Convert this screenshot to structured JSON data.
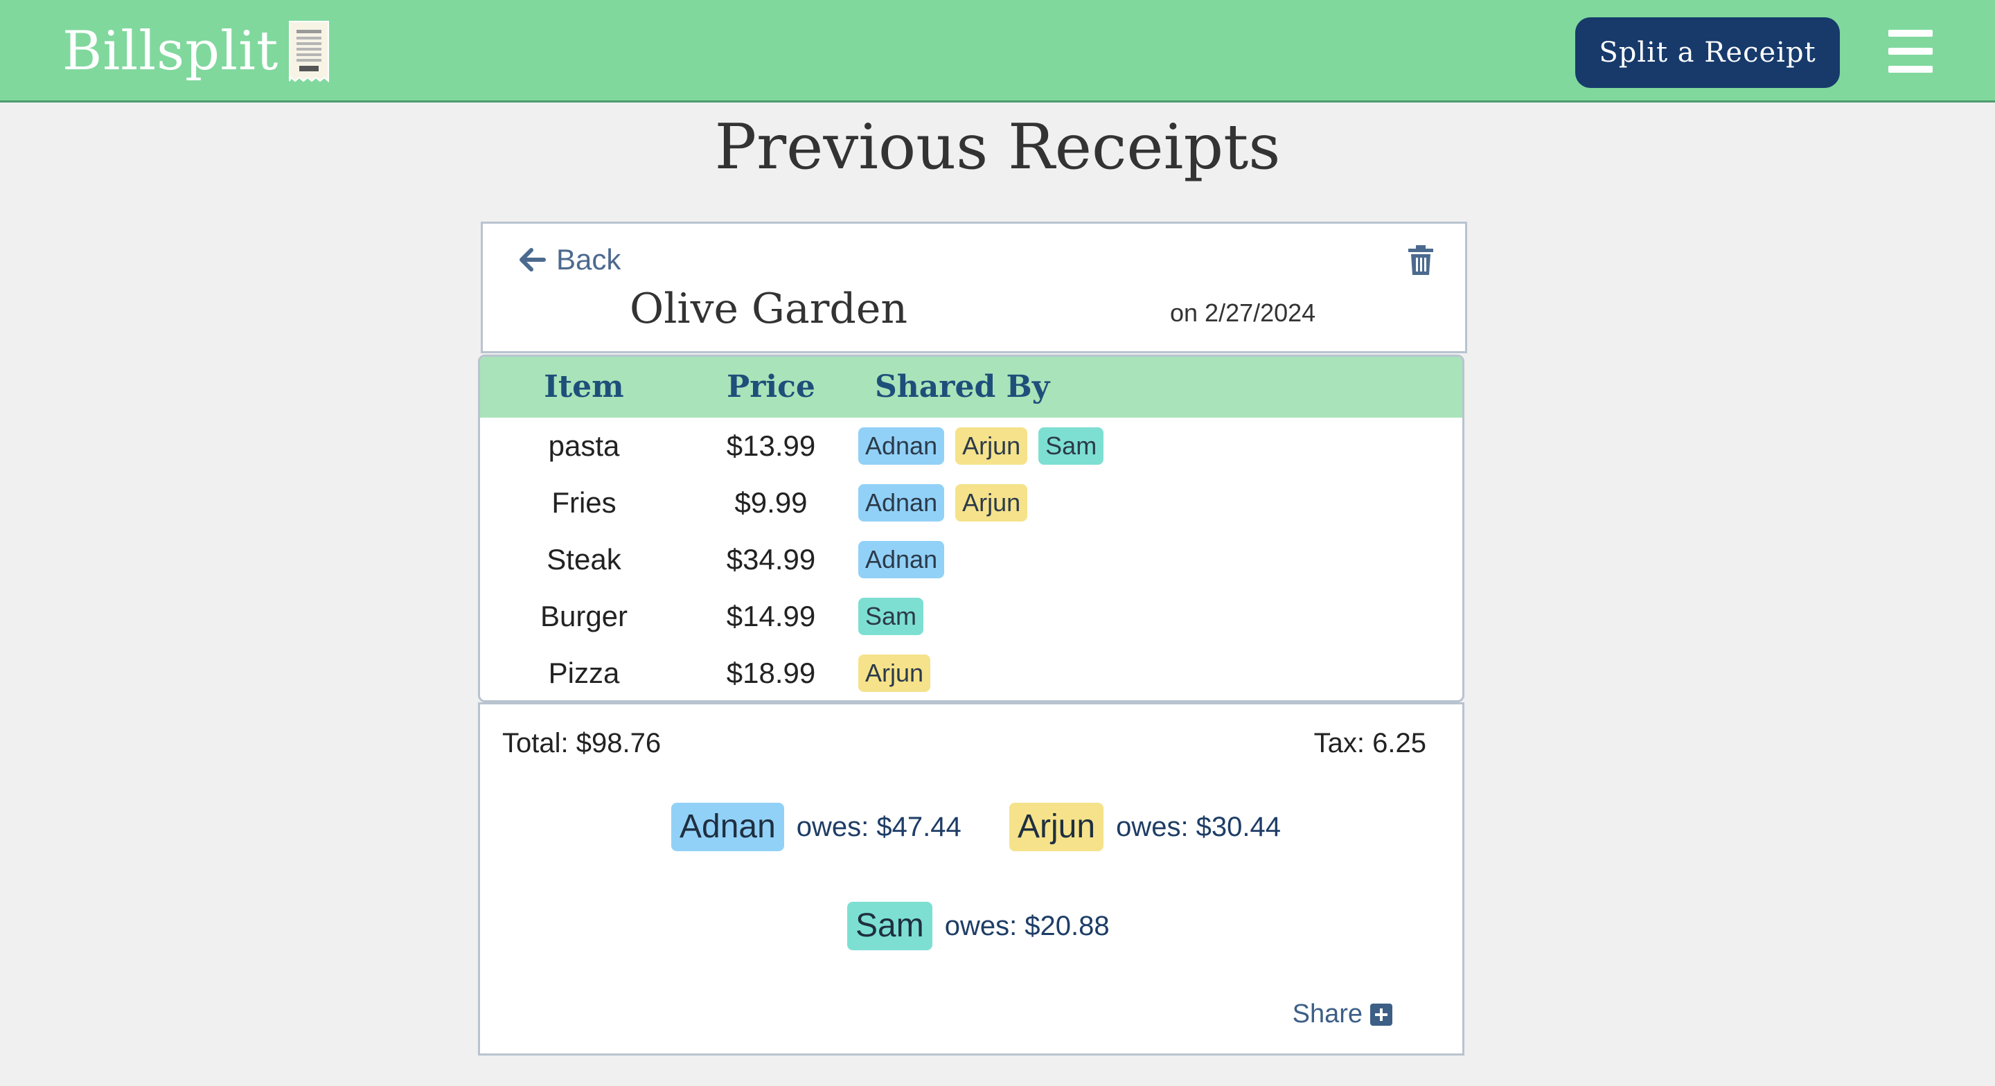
{
  "header": {
    "brand": "Billsplit",
    "split_button": "Split a Receipt"
  },
  "page_title": "Previous Receipts",
  "receipt": {
    "back_label": "Back",
    "restaurant": "Olive Garden",
    "date_text": "on 2/27/2024"
  },
  "table": {
    "columns": [
      "Item",
      "Price",
      "Shared By"
    ],
    "rows": [
      {
        "item": "pasta",
        "price": "$13.99",
        "shared_by": [
          "Adnan",
          "Arjun",
          "Sam"
        ]
      },
      {
        "item": "Fries",
        "price": "$9.99",
        "shared_by": [
          "Adnan",
          "Arjun"
        ]
      },
      {
        "item": "Steak",
        "price": "$34.99",
        "shared_by": [
          "Adnan"
        ]
      },
      {
        "item": "Burger",
        "price": "$14.99",
        "shared_by": [
          "Sam"
        ]
      },
      {
        "item": "Pizza",
        "price": "$18.99",
        "shared_by": [
          "Arjun"
        ]
      }
    ]
  },
  "summary": {
    "total": "Total: $98.76",
    "tax": "Tax: 6.25",
    "owes": [
      {
        "name": "Adnan",
        "text": "owes: $47.44"
      },
      {
        "name": "Arjun",
        "text": "owes: $30.44"
      },
      {
        "name": "Sam",
        "text": "owes: $20.88"
      }
    ],
    "share_label": "Share"
  },
  "colors": {
    "topbar": "#80d89d",
    "button": "#173a6b",
    "table_header": "#a9e3ba",
    "adnan": "#92d1f7",
    "arjun": "#f5e28a",
    "sam": "#7ddfd2"
  },
  "icons": {
    "brand": "receipt-icon",
    "menu": "hamburger-menu-icon",
    "back": "arrow-left-icon",
    "delete": "trash-icon",
    "share": "plus-square-icon"
  }
}
